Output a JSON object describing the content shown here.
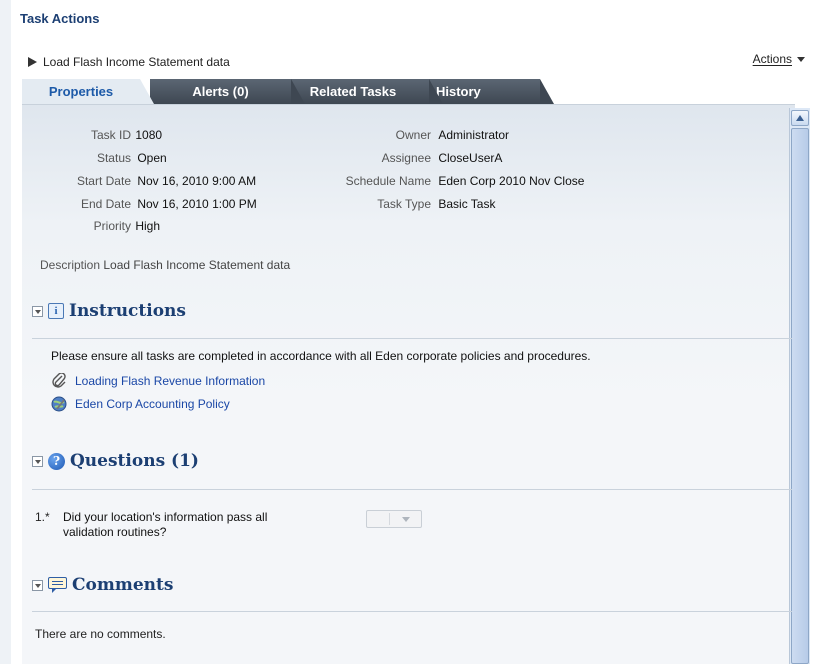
{
  "panel": {
    "title": "Task Actions"
  },
  "task": {
    "name": "Load Flash Income Statement data"
  },
  "actions_menu": {
    "label": "Actions"
  },
  "tabs": [
    {
      "label": "Properties",
      "active": true
    },
    {
      "label": "Alerts (0)",
      "active": false
    },
    {
      "label": "Related Tasks",
      "active": false
    },
    {
      "label": "History",
      "active": false
    }
  ],
  "properties": {
    "task_id": {
      "label": "Task ID",
      "value": "1080"
    },
    "status": {
      "label": "Status",
      "value": "Open"
    },
    "start_date": {
      "label": "Start Date",
      "value": "Nov 16, 2010 9:00 AM"
    },
    "end_date": {
      "label": "End Date",
      "value": "Nov 16, 2010 1:00 PM"
    },
    "priority": {
      "label": "Priority",
      "value": "High"
    },
    "owner": {
      "label": "Owner",
      "value": "Administrator"
    },
    "assignee": {
      "label": "Assignee",
      "value": "CloseUserA"
    },
    "schedule_name": {
      "label": "Schedule Name",
      "value": "Eden Corp 2010 Nov Close"
    },
    "task_type": {
      "label": "Task Type",
      "value": "Basic Task"
    },
    "description": {
      "label": "Description",
      "value": "Load Flash Income Statement data"
    }
  },
  "instructions": {
    "title": "Instructions",
    "text": "Please ensure all tasks are completed in accordance with all Eden corporate policies and procedures.",
    "links": [
      {
        "label": "Loading Flash Revenue Information",
        "icon": "paperclip-icon"
      },
      {
        "label": "Eden Corp Accounting Policy",
        "icon": "globe-link-icon"
      }
    ]
  },
  "questions": {
    "title": "Questions (1)",
    "items": [
      {
        "number": "1.*",
        "line1": "Did your location's information pass all",
        "line2": "validation routines?",
        "answer": ""
      }
    ]
  },
  "comments": {
    "title": "Comments",
    "empty_text": "There are no comments."
  },
  "colors": {
    "section_title": "#1c3f73",
    "link": "#1a47a6",
    "tab_dark": "#3e4752",
    "tab_active_text": "#1d5aa8"
  }
}
